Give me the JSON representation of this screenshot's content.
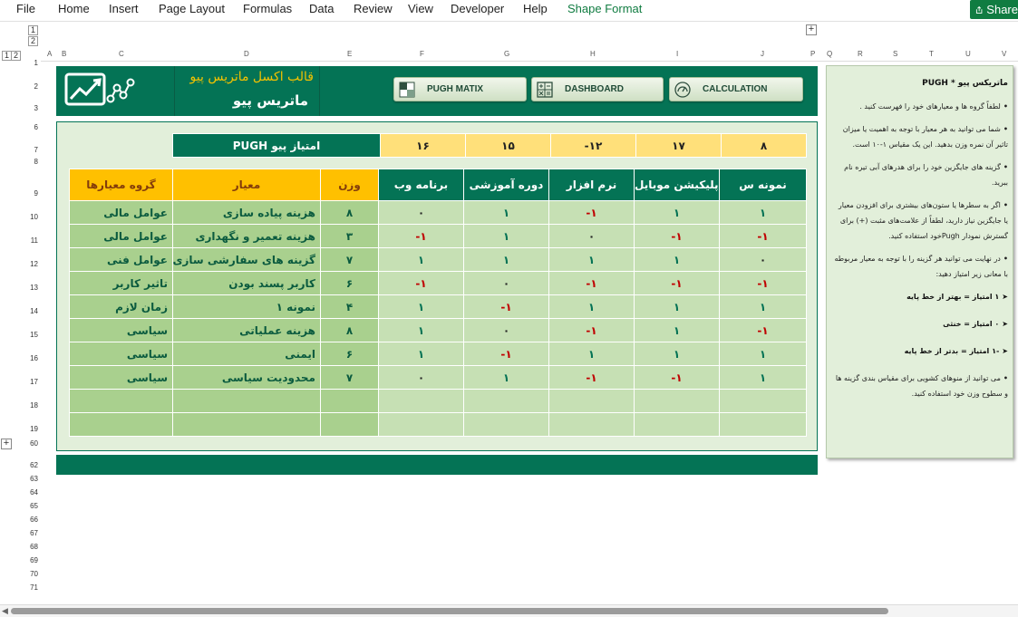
{
  "ribbon": {
    "tabs": [
      "File",
      "Home",
      "Insert",
      "Page Layout",
      "Formulas",
      "Data",
      "Review",
      "View",
      "Developer",
      "Help",
      "Shape Format"
    ],
    "share_label": "Share"
  },
  "outline": {
    "levels": [
      "1",
      "2"
    ],
    "expand_symbol": "+"
  },
  "column_letters": [
    "A",
    "B",
    "C",
    "D",
    "E",
    "F",
    "G",
    "H",
    "I",
    "J",
    "P",
    "Q",
    "R",
    "S",
    "T",
    "U",
    "V"
  ],
  "row_numbers": [
    "1",
    "2",
    "3",
    "6",
    "7",
    "8",
    "9",
    "10",
    "11",
    "12",
    "13",
    "14",
    "15",
    "16",
    "17",
    "18",
    "19",
    "60",
    "62",
    "63",
    "64",
    "65",
    "66",
    "67",
    "68",
    "69",
    "70",
    "71"
  ],
  "banner": {
    "subtitle": "قالب اکسل ماتریس پیو",
    "title": "ماتریس پیو",
    "buttons": [
      {
        "label": "PUGH MATIX",
        "icon": "grid-icon"
      },
      {
        "label": "DASHBOARD",
        "icon": "calculator-icon"
      },
      {
        "label": "CALCULATION",
        "icon": "gauge-icon"
      }
    ]
  },
  "score_row": {
    "label": "امتیاز پیو PUGH",
    "values": [
      "۱۶",
      "۱۵",
      "-۱۲",
      "۱۷",
      "۸"
    ]
  },
  "matrix": {
    "headers": {
      "group": "گروه معیارها",
      "criterion": "معیار",
      "weight": "وزن",
      "options": [
        "برنامه وب",
        "دوره آموزشی",
        "نرم افزار",
        "اپلیکیشن موبایل",
        "نمونه س"
      ]
    },
    "rows": [
      {
        "group": "عوامل مالی",
        "criterion": "هزینه پیاده سازی",
        "weight": "۸",
        "scores": [
          "۰",
          "۱",
          "-۱",
          "۱",
          "۱"
        ]
      },
      {
        "group": "عوامل مالی",
        "criterion": "هزینه تعمیر و نگهداری",
        "weight": "۳",
        "scores": [
          "-۱",
          "۱",
          "۰",
          "-۱",
          "-۱"
        ]
      },
      {
        "group": "عوامل فنی",
        "criterion": "گزینه های سفارشی سازی",
        "weight": "۷",
        "scores": [
          "۱",
          "۱",
          "۱",
          "۱",
          "۰"
        ]
      },
      {
        "group": "تاثیر کاربر",
        "criterion": "کاربر پسند بودن",
        "weight": "۶",
        "scores": [
          "-۱",
          "۰",
          "-۱",
          "-۱",
          "-۱"
        ]
      },
      {
        "group": "زمان لازم",
        "criterion": "نمونه ۱",
        "weight": "۴",
        "scores": [
          "۱",
          "-۱",
          "۱",
          "۱",
          "۱"
        ]
      },
      {
        "group": "سیاسی",
        "criterion": "هزینه عملیاتی",
        "weight": "۸",
        "scores": [
          "۱",
          "۰",
          "-۱",
          "۱",
          "-۱"
        ]
      },
      {
        "group": "سیاسی",
        "criterion": "ایمنی",
        "weight": "۶",
        "scores": [
          "۱",
          "-۱",
          "۱",
          "۱",
          "۱"
        ]
      },
      {
        "group": "سیاسی",
        "criterion": "محدودیت سیاسی",
        "weight": "۷",
        "scores": [
          "۰",
          "۱",
          "-۱",
          "-۱",
          "۱"
        ]
      },
      {
        "group": "",
        "criterion": "",
        "weight": "",
        "scores": [
          "",
          "",
          "",
          "",
          ""
        ]
      },
      {
        "group": "",
        "criterion": "",
        "weight": "",
        "scores": [
          "",
          "",
          "",
          "",
          ""
        ]
      }
    ]
  },
  "sidebar": {
    "title": "ماتریکس پیو * PUGH",
    "paragraphs": [
      "لطفاً گروه ها و معیارهای خود را فهرست کنید .",
      "شما می توانید به هر معیار با توجه به اهمیت یا میزان تاثیر آن نمره وزن بدهید. این یک مقیاس ۱-۱۰ است.",
      "گزینه های جایگزین خود را برای هدرهای آبی تیره نام ببرید.",
      "اگر به سطرها یا ستون‌های بیشتری برای افزودن معیار یا جایگزین نیاز دارید، لطفاً از علامت‌های مثبت (+) برای گسترش نمودار Pughخود استفاده کنید.",
      "در نهایت می توانید هر گزینه را با توجه به معیار مربوطه با معانی زیر امتیاز دهید:"
    ],
    "scale": [
      "۱ امتیاز = بهتر از خط پایه",
      "۰ امتیاز = خنثی",
      "-۱ امتیاز = بدتر از خط پایه"
    ],
    "final": "می توانید از منوهای کشویی برای مقیاس بندی گزینه ها و سطوح وزن خود استفاده کنید."
  }
}
